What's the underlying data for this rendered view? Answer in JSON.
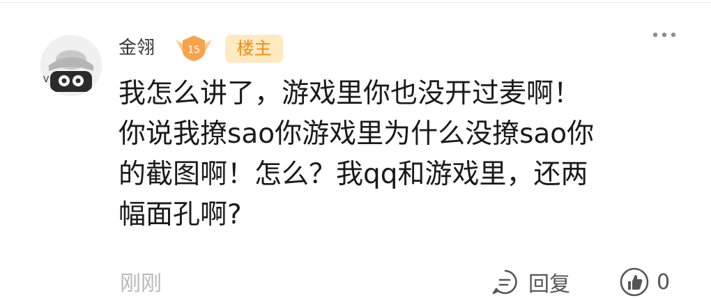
{
  "comment": {
    "username": "金翎",
    "level": "15",
    "op_badge": "楼主",
    "lines": [
      "我怎么讲了，游戏里你也没开过麦啊！",
      "你说我撩sao你游戏里为什么没撩sao你",
      "的截图啊！怎么？我qq和游戏里，还两",
      "幅面孔啊?"
    ],
    "timestamp": "刚刚"
  },
  "actions": {
    "reply_label": "回复",
    "like_count": "0"
  },
  "colors": {
    "op_badge_bg": "#ffe9c0",
    "op_badge_text": "#f28c1a",
    "level_badge": "#f7a34a",
    "timestamp": "#b8b8b8"
  },
  "icons": {
    "more": "more-icon",
    "reply": "reply-icon",
    "like": "thumbs-up-icon",
    "level": "level-badge-icon"
  }
}
